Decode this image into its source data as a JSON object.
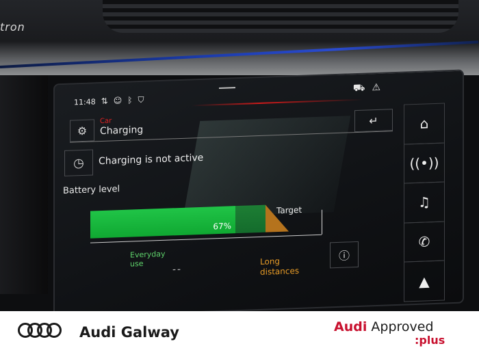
{
  "surroundings": {
    "badge": "tron"
  },
  "status_bar": {
    "time": "11:48",
    "icons": [
      "network-icon",
      "person-icon",
      "bluetooth-icon",
      "shield-icon"
    ],
    "right_icons": [
      "car-warning-icon",
      "warning-triangle-icon"
    ]
  },
  "header": {
    "breadcrumb": "Car",
    "title": "Charging"
  },
  "charging": {
    "status": "Charging is not active",
    "battery_level_label": "Battery level",
    "percent_label": "67%",
    "percent_value": 67,
    "target_label": "Target",
    "everyday_label_line1": "Everyday",
    "everyday_label_line2": "use",
    "dashes": "--",
    "long_label_line1": "Long",
    "long_label_line2": "distances"
  },
  "nav": {
    "items": [
      {
        "name": "home",
        "icon": "home-icon"
      },
      {
        "name": "radio",
        "icon": "radio-antenna-icon"
      },
      {
        "name": "media",
        "icon": "music-note-icon"
      },
      {
        "name": "phone",
        "icon": "phone-icon"
      },
      {
        "name": "navigation",
        "icon": "navigation-arrow-icon"
      }
    ]
  },
  "footer": {
    "dealer": "Audi Galway",
    "approved_brand": "Audi",
    "approved_text": "Approved",
    "plus": ":plus"
  },
  "colors": {
    "battery_green": "#20c447",
    "orange": "#b5731d",
    "audi_red": "#c8102e"
  }
}
